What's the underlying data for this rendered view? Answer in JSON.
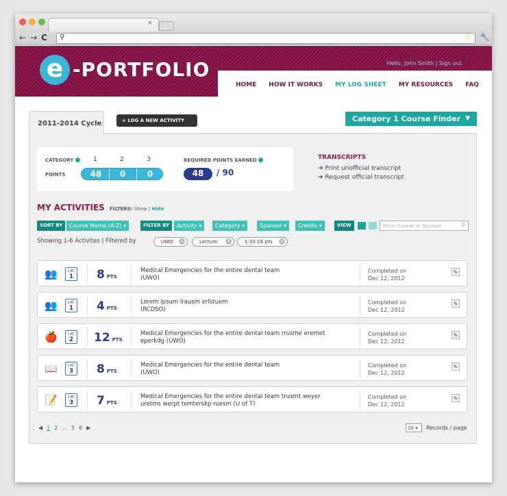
{
  "browser": {
    "url": "",
    "tab_close": "×",
    "back": "←",
    "forward": "→",
    "reload": "C",
    "search_glyph": "⚲",
    "star_glyph": "☆",
    "wrench_glyph": "🔧"
  },
  "header": {
    "logo_letter": "e",
    "logo_text": "-PORTFOLIO",
    "greeting": "Hello, John Smith | Sign out",
    "nav": [
      "HOME",
      "HOW IT WORKS",
      "MY LOG SHEET",
      "MY RESOURCES",
      "FAQ"
    ],
    "active_nav": "MY LOG SHEET"
  },
  "cycle_tab": "2011-2014 Cycle",
  "log_button": "+ LOG A NEW ACTIVITY",
  "course_finder": {
    "label": "Category 1 Course Finder",
    "arrow": "▼"
  },
  "points": {
    "category_label": "CATEGORY",
    "points_label": "POINTS",
    "categories": [
      "1",
      "2",
      "3"
    ],
    "values": [
      "48",
      "0",
      "0"
    ],
    "required_label": "REQUIRED POINTS EARNED",
    "earned": "48",
    "required_total": "/ 90"
  },
  "transcripts": {
    "title": "TRANSCRIPTS",
    "links": [
      "➜ Print unofficial transcript",
      "➜ Request official transcript"
    ]
  },
  "activities": {
    "title": "MY ACTIVITIES",
    "filters_label": "FILTERS:",
    "show": "Show",
    "hide": "Hide",
    "sort_by": "SORT BY",
    "sort_value": "Course Name (A-Z) ▾",
    "filter_by": "FILTER BY",
    "filters": [
      "Activity ▾",
      "Category ▾",
      "Sponsor ▾",
      "Credits ▾"
    ],
    "view": "VIEW",
    "search_placeholder": "Enter Course or Sponsor",
    "showing": "Showing 1-6 Activites  |  Filtered by",
    "chips": [
      "UWO",
      "Lecture",
      "1-10 CE pts"
    ],
    "cat_label": "CAT.",
    "pts_label": "PTS",
    "rows": [
      {
        "icon": "presentation-icon",
        "glyph": "👥",
        "cat": "1",
        "pts": "8",
        "title": "Medical Emergencies for the entire dental team",
        "sponsor": "(UWO)",
        "status": "Completed on",
        "date": "Dec 12, 2012"
      },
      {
        "icon": "presentation-icon",
        "glyph": "👥",
        "cat": "1",
        "pts": "4",
        "title": "Lorem ipsum lrausm erlstuem",
        "sponsor": "(RCDSO)",
        "status": "Completed on",
        "date": "Dec 12, 2012"
      },
      {
        "icon": "apple-icon",
        "glyph": "🍎",
        "cat": "2",
        "pts": "12",
        "title": "Medical Emergencies for the entire dental team rrusme eremet",
        "sponsor": "eperkdg (UWO)",
        "status": "Completed on",
        "date": "Dec 12, 2012"
      },
      {
        "icon": "reading-icon",
        "glyph": "📖",
        "cat": "3",
        "pts": "8",
        "title": "Medical Emergencies for the entire dental team",
        "sponsor": "(UWO)",
        "status": "Completed on",
        "date": "Dec 12, 2012"
      },
      {
        "icon": "document-edit-icon",
        "glyph": "📝",
        "cat": "3",
        "pts": "7",
        "title": "Medical Emergencies for the entire dental team trusmt weyer",
        "sponsor": "uretms werpt temterskp ruesm (U of T)",
        "status": "Completed on",
        "date": "Dec 12, 2012"
      }
    ]
  },
  "pagination": {
    "prev": "◀",
    "pages": [
      "1",
      "2",
      "...",
      "5",
      "6"
    ],
    "next": "▶",
    "records_value": "20",
    "records_label": "Records / page"
  },
  "colors": {
    "brand": "#8e1a4f",
    "accent": "#1aa8a0",
    "navy": "#2d3b8c",
    "sky": "#3bb6d8"
  }
}
